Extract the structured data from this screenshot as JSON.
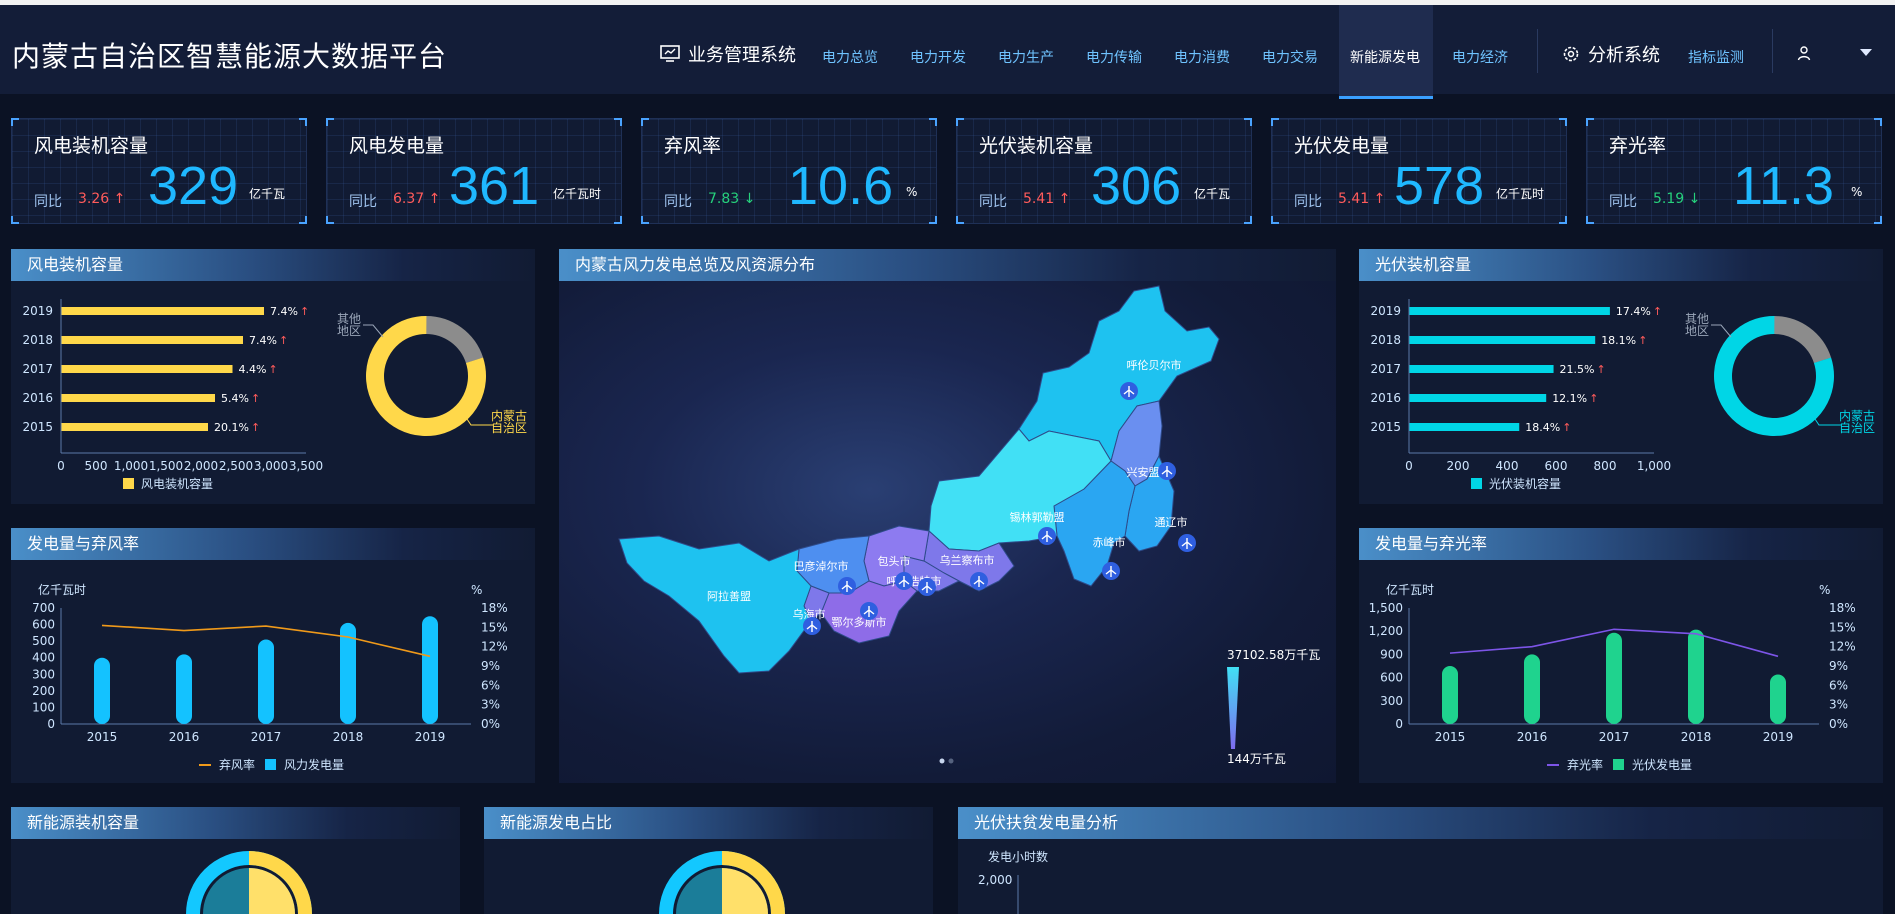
{
  "header": {
    "title": "内蒙古自治区智慧能源大数据平台",
    "business_system": "业务管理系统",
    "nav": [
      "电力总览",
      "电力开发",
      "电力生产",
      "电力传输",
      "电力消费",
      "电力交易",
      "新能源发电",
      "电力经济"
    ],
    "active_nav": "新能源发电",
    "analysis_system": "分析系统",
    "monitor": "指标监测",
    "icons": {
      "business": "monitor-icon",
      "analysis": "gear-icon",
      "user": "user-icon",
      "dropdown": "chevron-down-icon"
    }
  },
  "kpis": [
    {
      "title": "风电装机容量",
      "yoy_label": "同比",
      "yoy": "3.26",
      "trend": "up",
      "value": "329",
      "unit": "亿千瓦"
    },
    {
      "title": "风电发电量",
      "yoy_label": "同比",
      "yoy": "6.37",
      "trend": "up",
      "value": "361",
      "unit": "亿千瓦时"
    },
    {
      "title": "弃风率",
      "yoy_label": "同比",
      "yoy": "7.83",
      "trend": "down",
      "value": "10.6",
      "unit": "%"
    },
    {
      "title": "光伏装机容量",
      "yoy_label": "同比",
      "yoy": "5.41",
      "trend": "up",
      "value": "306",
      "unit": "亿千瓦"
    },
    {
      "title": "光伏发电量",
      "yoy_label": "同比",
      "yoy": "5.41",
      "trend": "up",
      "value": "578",
      "unit": "亿千瓦时"
    },
    {
      "title": "弃光率",
      "yoy_label": "同比",
      "yoy": "5.19",
      "trend": "down",
      "value": "11.3",
      "unit": "%"
    }
  ],
  "colors": {
    "wind": "#ffd84a",
    "solar": "#00d6e6",
    "wind_gen": "#14c2ff",
    "solar_gen": "#1fd38e",
    "curtail_wind": "#f09a1a",
    "curtail_solar": "#7d55e8",
    "other": "#8c8c8c"
  },
  "panels": {
    "wind_capacity": "风电装机容量",
    "wind_gen": "发电量与弃风率",
    "map": "内蒙古风力发电总览及风资源分布",
    "solar_capacity": "光伏装机容量",
    "solar_gen": "发电量与弃光率",
    "ne_capacity": "新能源装机容量",
    "ne_ratio": "新能源发电占比",
    "poverty": "光伏扶贫发电量分析"
  },
  "map": {
    "regions": [
      "呼伦贝尔市",
      "兴安盟",
      "通辽市",
      "赤峰市",
      "锡林郭勒盟",
      "乌兰察布市",
      "呼和浩特市",
      "包头市",
      "巴彦淖尔市",
      "鄂尔多斯市",
      "乌海市",
      "阿拉善盟"
    ],
    "legend_max": "37102.58万千瓦",
    "legend_min": "144万千瓦",
    "turbine_icon": "wind-turbine-icon"
  },
  "poverty": {
    "ylabel": "发电小时数",
    "ytick": "2,000"
  },
  "chart_data": [
    {
      "type": "bar",
      "id": "wind_capacity_bars",
      "title": "风电装机容量",
      "categories": [
        "2019",
        "2018",
        "2017",
        "2016",
        "2015"
      ],
      "values": [
        2900,
        2600,
        2450,
        2200,
        2100
      ],
      "growth": [
        "7.4%",
        "7.4%",
        "4.4%",
        "5.4%",
        "20.1%"
      ],
      "xlim": [
        0,
        3500
      ],
      "xticks": [
        "0",
        "500",
        "1,000",
        "1,500",
        "2,000",
        "2,500",
        "3,000",
        "3,500"
      ],
      "legend": "风电装机容量"
    },
    {
      "type": "pie",
      "id": "wind_share",
      "labels": [
        "其他地区",
        "内蒙古自治区"
      ],
      "values": [
        20,
        80
      ]
    },
    {
      "type": "bar",
      "id": "wind_gen",
      "categories": [
        "2015",
        "2016",
        "2017",
        "2018",
        "2019"
      ],
      "series": [
        {
          "name": "风力发电量",
          "kind": "bar",
          "values": [
            400,
            420,
            510,
            610,
            650
          ]
        },
        {
          "name": "弃风率",
          "kind": "line",
          "values": [
            15.3,
            14.5,
            15.2,
            13.5,
            10.5
          ]
        }
      ],
      "ylabel_left": "亿千瓦时",
      "ylabel_right": "%",
      "ylim_left": [
        0,
        700
      ],
      "yticks_left": [
        "0",
        "100",
        "200",
        "300",
        "400",
        "500",
        "600",
        "700"
      ],
      "ylim_right": [
        0,
        18
      ],
      "yticks_right": [
        "0%",
        "3%",
        "6%",
        "9%",
        "12%",
        "15%",
        "18%"
      ]
    },
    {
      "type": "bar",
      "id": "solar_capacity_bars",
      "title": "光伏装机容量",
      "categories": [
        "2019",
        "2018",
        "2017",
        "2016",
        "2015"
      ],
      "values": [
        820,
        760,
        590,
        560,
        450
      ],
      "growth": [
        "17.4%",
        "18.1%",
        "21.5%",
        "12.1%",
        "18.4%"
      ],
      "xlim": [
        0,
        1000
      ],
      "xticks": [
        "0",
        "200",
        "400",
        "600",
        "800",
        "1,000"
      ],
      "legend": "光伏装机容量"
    },
    {
      "type": "pie",
      "id": "solar_share",
      "labels": [
        "其他地区",
        "内蒙古自治区"
      ],
      "values": [
        20,
        80
      ]
    },
    {
      "type": "bar",
      "id": "solar_gen",
      "categories": [
        "2015",
        "2016",
        "2017",
        "2018",
        "2019"
      ],
      "series": [
        {
          "name": "光伏发电量",
          "kind": "bar",
          "values": [
            750,
            900,
            1180,
            1220,
            640
          ]
        },
        {
          "name": "弃光率",
          "kind": "line",
          "values": [
            11,
            12,
            14.7,
            14,
            10.5
          ]
        }
      ],
      "ylabel_left": "亿千瓦时",
      "ylabel_right": "%",
      "ylim_left": [
        0,
        1500
      ],
      "yticks_left": [
        "0",
        "300",
        "600",
        "900",
        "1,200",
        "1,500"
      ],
      "ylim_right": [
        0,
        18
      ],
      "yticks_right": [
        "0%",
        "3%",
        "6%",
        "9%",
        "12%",
        "15%",
        "18%"
      ]
    }
  ]
}
